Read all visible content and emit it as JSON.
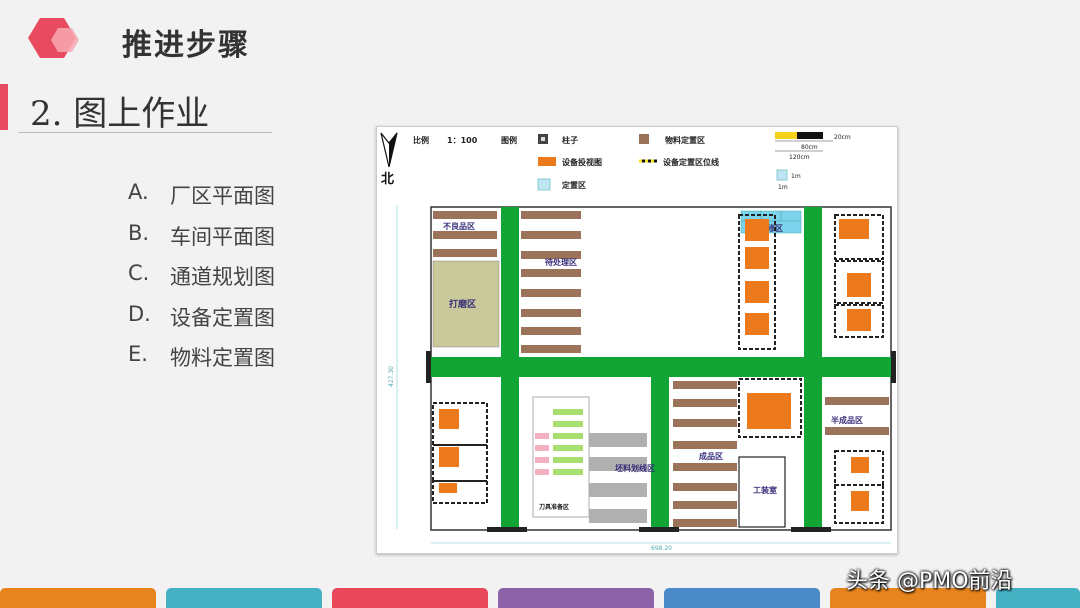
{
  "header": {
    "title": "推进步骤"
  },
  "section": {
    "title": "2. 图上作业"
  },
  "list": [
    {
      "letter": "A.",
      "text": "厂区平面图"
    },
    {
      "letter": "B.",
      "text": "车间平面图"
    },
    {
      "letter": "C.",
      "text": "通道规划图"
    },
    {
      "letter": "D.",
      "text": "设备定置图"
    },
    {
      "letter": "E.",
      "text": "物料定置图"
    }
  ],
  "plan": {
    "north": "北",
    "scale_label": "比例",
    "scale_value": "1：100",
    "legend_label": "图例",
    "legend": {
      "pillar": "柱子",
      "material": "物料定置区",
      "equipment": "设备投视图",
      "equip_line": "设备定置区位线",
      "fixed": "定置区"
    },
    "scale_bar": {
      "a": "20cm",
      "b": "80cm",
      "c": "120cm",
      "d": "1m",
      "e": "1m"
    },
    "dims": {
      "height": "427.30",
      "width": "698.20"
    },
    "zones": {
      "defect": "不良品区",
      "pending": "待处理区",
      "grind": "打磨区",
      "repair": "返修区",
      "semi": "半成品区",
      "finished": "成品区",
      "fixture": "工装室",
      "tool": "刀具准备区",
      "billet": "坯料划线区"
    }
  },
  "watermark": "头条 @PMO前沿",
  "colors": {
    "accent_red": "#e84a5f",
    "aisle_green": "#12a535",
    "equip_orange": "#ec7a1c",
    "material_brown": "#9b7358"
  },
  "footer_tabs": [
    "#e8841e",
    "#45b2c4",
    "#e8485a",
    "#8c63a8",
    "#4a8ac8",
    "#e8841e",
    "#45b2c4"
  ]
}
